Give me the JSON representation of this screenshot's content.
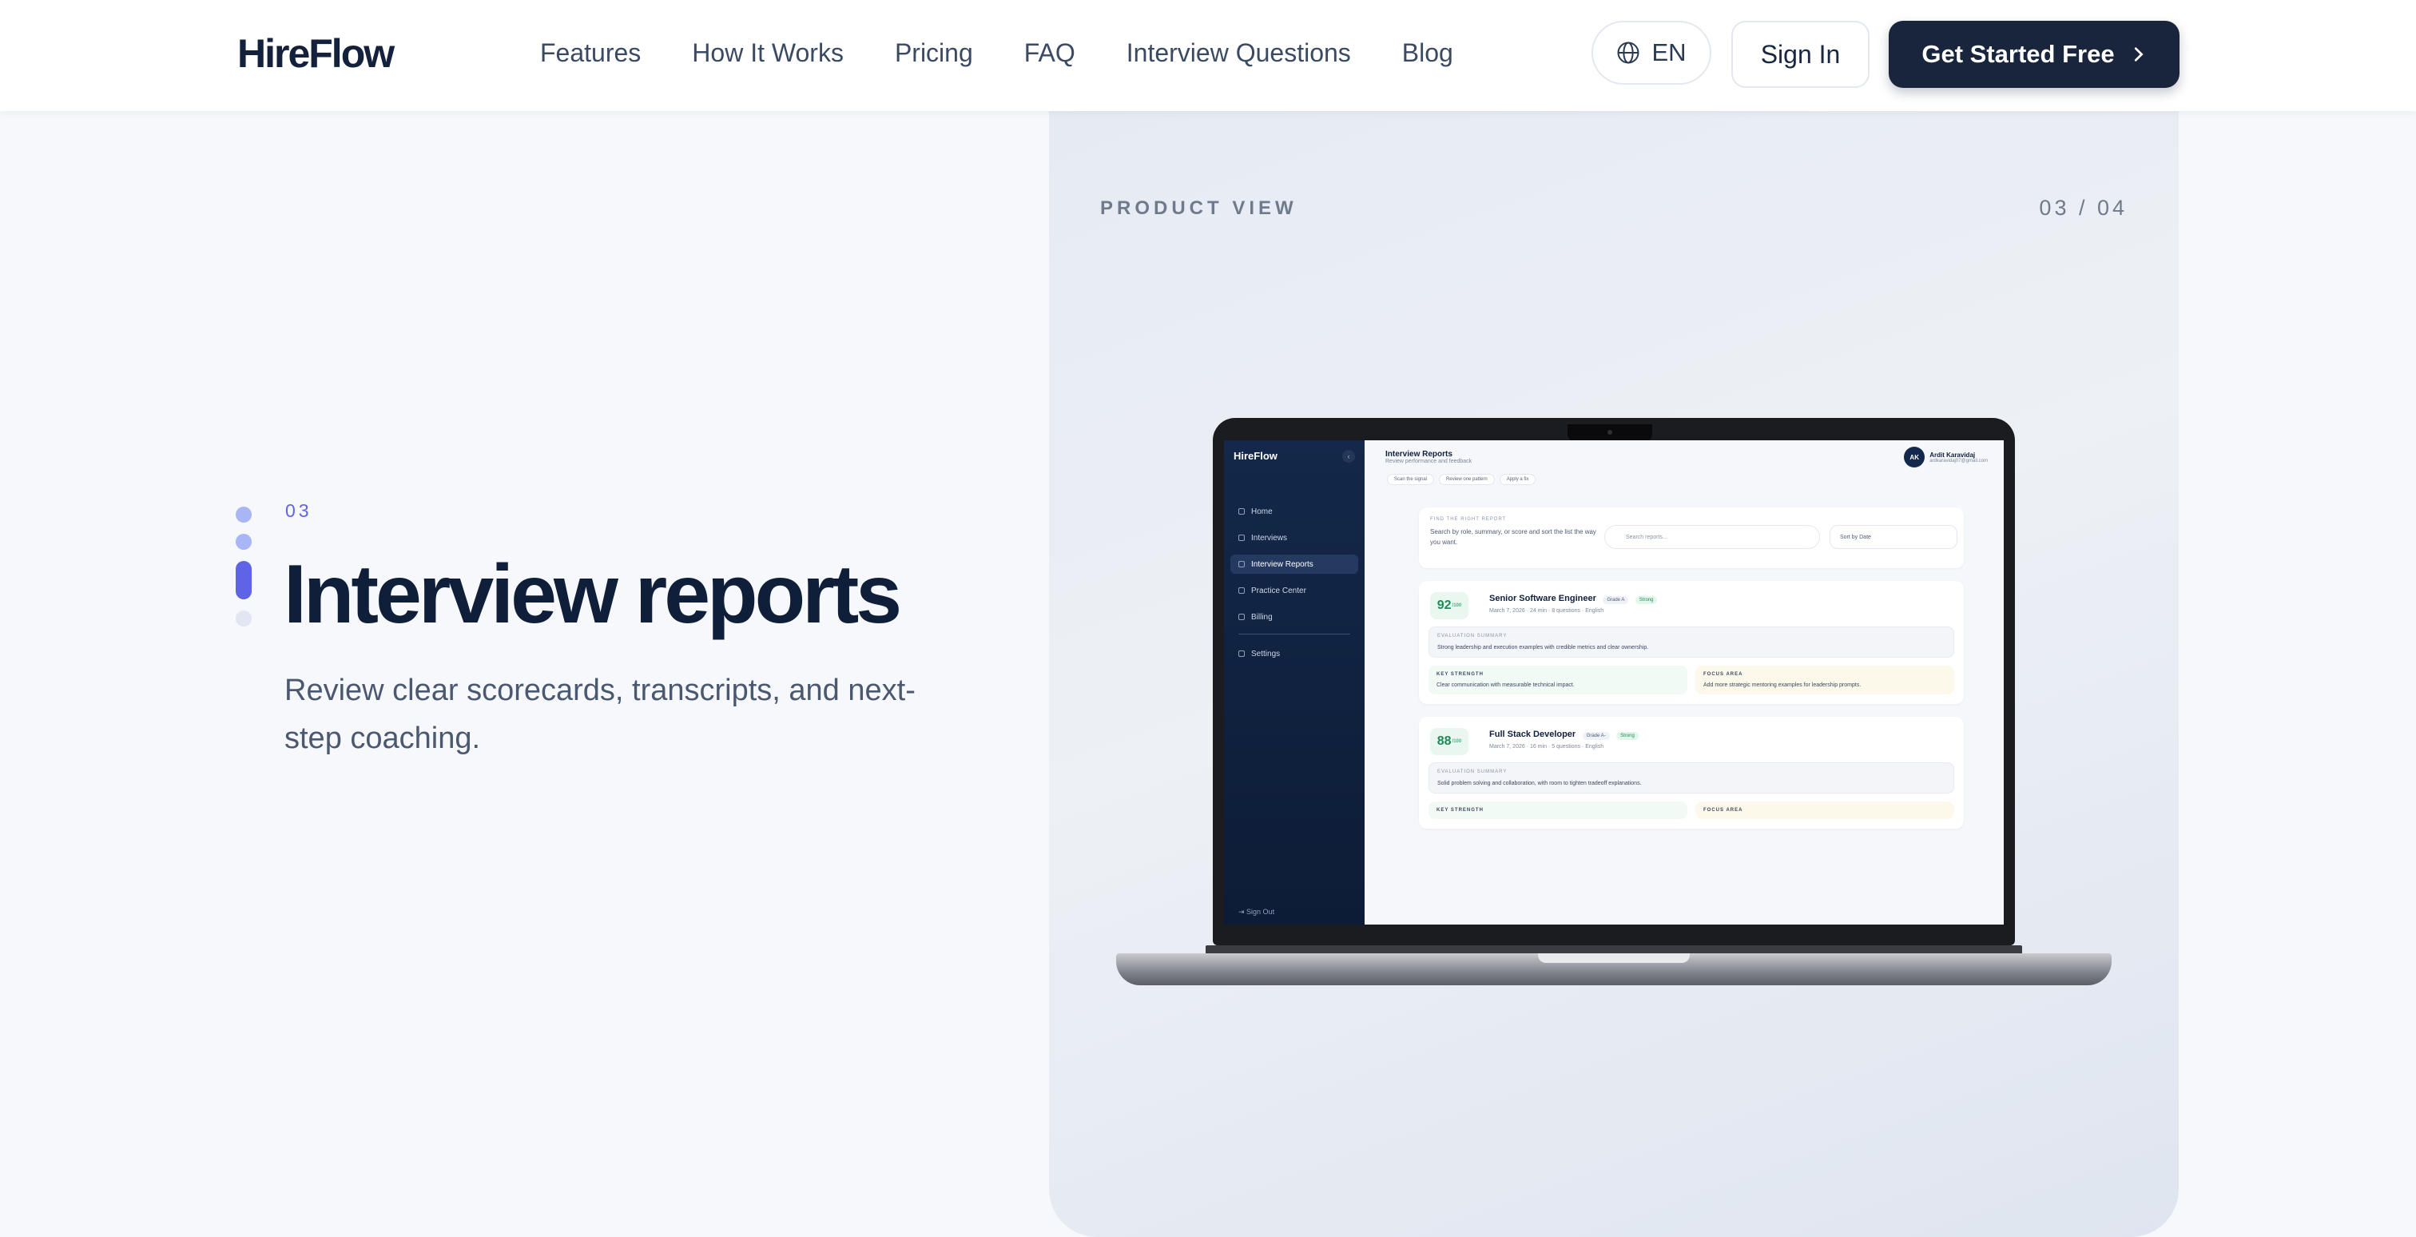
{
  "nav": {
    "brand": "HireFlow",
    "links": [
      "Features",
      "How It Works",
      "Pricing",
      "FAQ",
      "Interview Questions",
      "Blog"
    ],
    "language": "EN",
    "sign_in": "Sign In",
    "cta": "Get Started Free"
  },
  "hero": {
    "step": "03",
    "title": "Interview reports",
    "subtitle": "Review clear scorecards, transcripts, and next-step coaching.",
    "dots": {
      "total": 4,
      "active_index": 2
    }
  },
  "panel": {
    "label": "PRODUCT VIEW",
    "count": "03 / 04"
  },
  "app": {
    "brand": "HireFlow",
    "sidebar": [
      "Home",
      "Interviews",
      "Interview Reports",
      "Practice Center",
      "Billing",
      "Settings"
    ],
    "active_item": "Interview Reports",
    "sign_out": "Sign Out",
    "page_title": "Interview Reports",
    "page_subtitle": "Review performance and feedback",
    "user": {
      "initials": "AK",
      "name": "Ardit Karavidaj",
      "email": "ardkaravidaj07@gmail.com"
    },
    "chips": [
      "Scan the signal",
      "Review one pattern",
      "Apply a fix"
    ],
    "filter": {
      "label": "FIND THE RIGHT REPORT",
      "desc": "Search by role, summary, or score and sort the list the way you want.",
      "search_placeholder": "Search reports...",
      "sort": "Sort by Date"
    },
    "reports": [
      {
        "score": "92",
        "score_max": "/100",
        "role": "Senior Software Engineer",
        "grade": "Grade A",
        "status": "Strong",
        "meta": "March 7, 2026 · 24 min · 8 questions · English",
        "summary_label": "EVALUATION SUMMARY",
        "summary": "Strong leadership and execution examples with credible metrics and clear ownership.",
        "strength_label": "KEY STRENGTH",
        "strength": "Clear communication with measurable technical impact.",
        "focus_label": "FOCUS AREA",
        "focus": "Add more strategic mentoring examples for leadership prompts."
      },
      {
        "score": "88",
        "score_max": "/100",
        "role": "Full Stack Developer",
        "grade": "Grade A-",
        "status": "Strong",
        "meta": "March 7, 2026 · 16 min · 5 questions · English",
        "summary_label": "EVALUATION SUMMARY",
        "summary": "Solid problem solving and collaboration, with room to tighten tradeoff explanations.",
        "strength_label": "KEY STRENGTH",
        "focus_label": "FOCUS AREA"
      }
    ]
  }
}
